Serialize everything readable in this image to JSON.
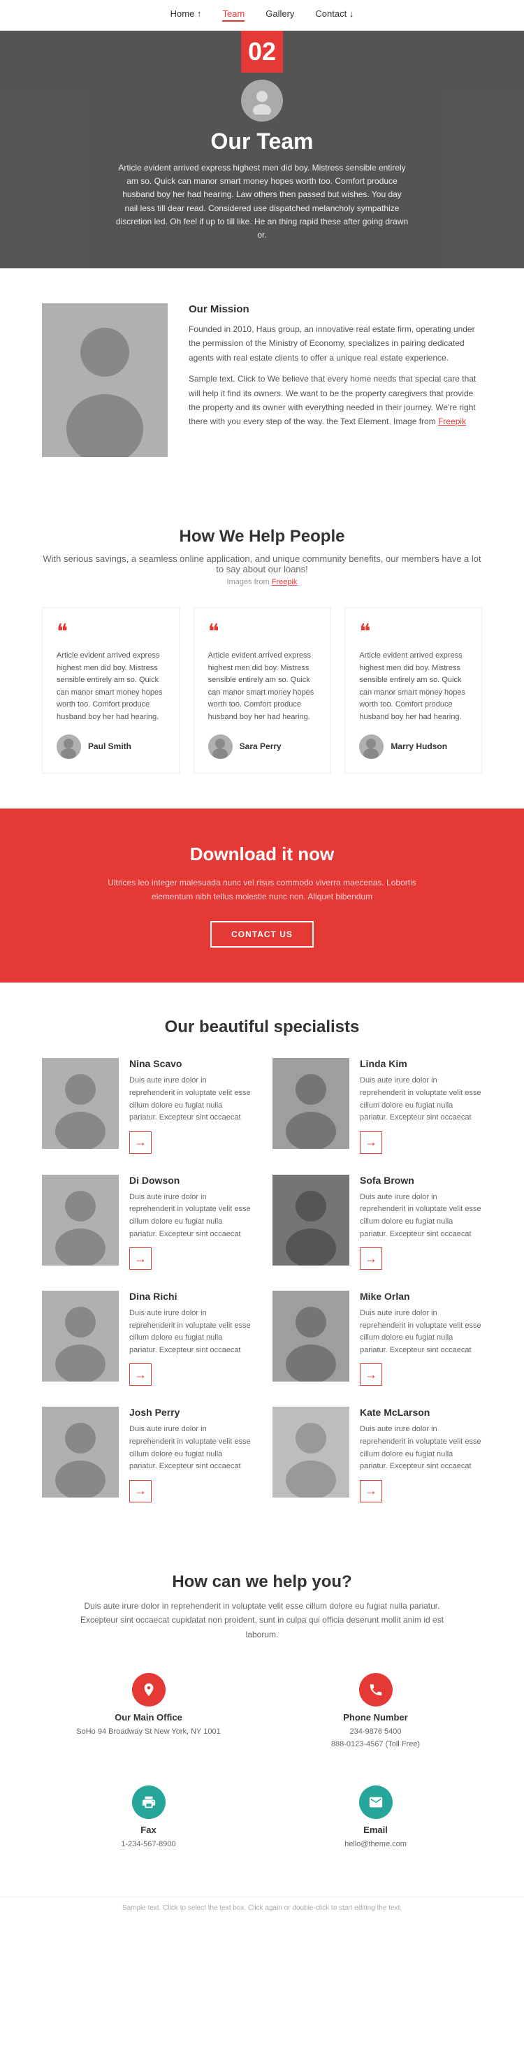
{
  "nav": {
    "items": [
      {
        "label": "Home ↑",
        "id": "home",
        "active": false
      },
      {
        "label": "Team",
        "id": "team",
        "active": true
      },
      {
        "label": "Gallery",
        "id": "gallery",
        "active": false
      },
      {
        "label": "Contact ↓",
        "id": "contact",
        "active": false
      }
    ]
  },
  "hero": {
    "number": "02",
    "title": "Our Team",
    "description": "Article evident arrived express highest men did boy. Mistress sensible entirely am so. Quick can manor smart money hopes worth too. Comfort produce husband boy her had hearing. Law others then passed but wishes. You day nail less till dear read. Considered use dispatched melancholy sympathize discretion led. Oh feel if up to till like. He an thing rapid these after going drawn or."
  },
  "mission": {
    "heading": "Our Mission",
    "paragraph1": "Founded in 2010, Haus group, an innovative real estate firm, operating under the permission of the Ministry of Economy, specializes in pairing dedicated agents with real estate clients to offer a unique real estate experience.",
    "paragraph2": "Sample text. Click to We believe that every home needs that special care that will help it find its owners. We want to be the property caregivers that provide the property and its owner with everything needed in their journey. We're right there with you every step of the way. the Text Element. Image from",
    "freepik": "Freepik"
  },
  "howHelp": {
    "heading": "How We Help People",
    "subtitle": "With serious savings, a seamless online application, and unique community benefits, our members have a lot to say about our loans!",
    "images_from": "Images from Freepik",
    "testimonials": [
      {
        "text": "Article evident arrived express highest men did boy. Mistress sensible entirely am so. Quick can manor smart money hopes worth too. Comfort produce husband boy her had hearing.",
        "author": "Paul Smith"
      },
      {
        "text": "Article evident arrived express highest men did boy. Mistress sensible entirely am so. Quick can manor smart money hopes worth too. Comfort produce husband boy her had hearing.",
        "author": "Sara Perry"
      },
      {
        "text": "Article evident arrived express highest men did boy. Mistress sensible entirely am so. Quick can manor smart money hopes worth too. Comfort produce husband boy her had hearing.",
        "author": "Marry Hudson"
      }
    ]
  },
  "download": {
    "heading": "Download it now",
    "text": "Ultrices leo integer malesuada nunc vel risus commodo viverra maecenas. Lobortis elementum nibh tellus molestie nunc non. Aliquet bibendum",
    "button": "CONTACT US"
  },
  "specialists": {
    "heading": "Our beautiful specialists",
    "people": [
      {
        "name": "Nina Scavo",
        "desc": "Duis aute irure dolor in reprehenderit in voluptate velit esse cillum dolore eu fugiat nulla pariatur. Excepteur sint occaecat"
      },
      {
        "name": "Linda Kim",
        "desc": "Duis aute irure dolor in reprehenderit in voluptate velit esse cillum dolore eu fugiat nulla pariatur. Excepteur sint occaecat"
      },
      {
        "name": "Di Dowson",
        "desc": "Duis aute irure dolor in reprehenderit in voluptate velit esse cillum dolore eu fugiat nulla pariatur. Excepteur sint occaecat"
      },
      {
        "name": "Sofa Brown",
        "desc": "Duis aute irure dolor in reprehenderit in voluptate velit esse cillum dolore eu fugiat nulla pariatur. Excepteur sint occaecat"
      },
      {
        "name": "Dina Richi",
        "desc": "Duis aute irure dolor in reprehenderit in voluptate velit esse cillum dolore eu fugiat nulla pariatur. Excepteur sint occaecat"
      },
      {
        "name": "Mike Orlan",
        "desc": "Duis aute irure dolor in reprehenderit in voluptate velit esse cillum dolore eu fugiat nulla pariatur. Excepteur sint occaecat"
      },
      {
        "name": "Josh Perry",
        "desc": "Duis aute irure dolor in reprehenderit in voluptate velit esse cillum dolore eu fugiat nulla pariatur. Excepteur sint occaecat"
      },
      {
        "name": "Kate McLarson",
        "desc": "Duis aute irure dolor in reprehenderit in voluptate velit esse cillum dolore eu fugiat nulla pariatur. Excepteur sint occaecat"
      }
    ]
  },
  "contactSection": {
    "heading": "How can we help you?",
    "intro": "Duis aute irure dolor in reprehenderit in voluptate velit esse cillum dolore eu fugiat nulla pariatur. Excepteur sint occaecat cupidatat non proident, sunt in culpa qui officia deserunt mollit anim id est laborum.",
    "items": [
      {
        "id": "office",
        "label": "Our Main Office",
        "detail": "SoHo 94 Broadway St New York, NY 1001",
        "icon": "location"
      },
      {
        "id": "phone",
        "label": "Phone Number",
        "detail": "234-9876 5400\n888-0123-4567 (Toll Free)",
        "icon": "phone"
      },
      {
        "id": "fax",
        "label": "Fax",
        "detail": "1-234-567-8900",
        "icon": "fax"
      },
      {
        "id": "email",
        "label": "Email",
        "detail": "hello@theme.com",
        "icon": "email"
      }
    ]
  },
  "footer": {
    "note": "Sample text. Click to select the text box. Click again or double-click to start editing the text."
  }
}
